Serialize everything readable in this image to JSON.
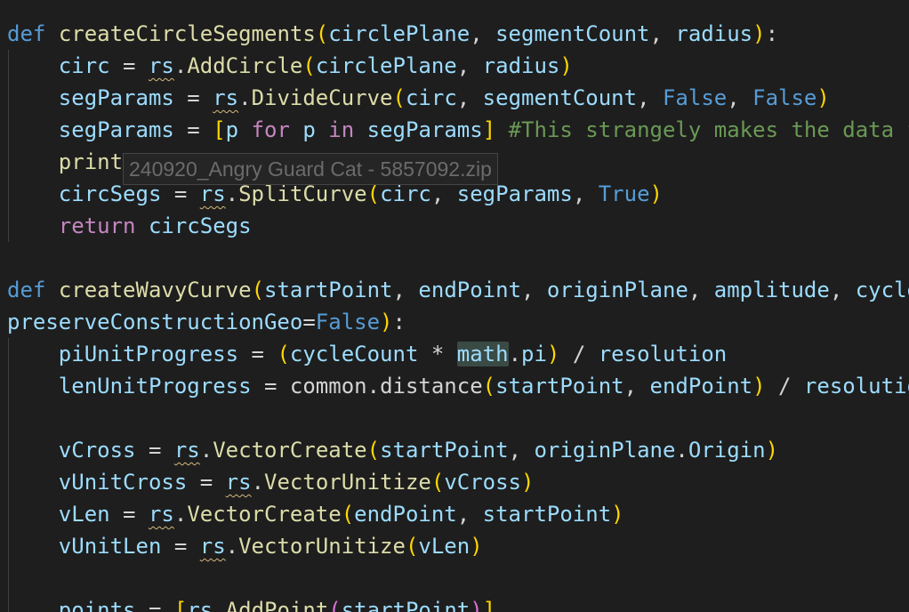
{
  "tooltip": {
    "filename": "240920_Angry Guard Cat - 5857092.zip"
  },
  "code": {
    "l1": {
      "def": "def",
      "fname": "createCircleSegments",
      "p1": "circlePlane",
      "p2": "segmentCount",
      "p3": "radius"
    },
    "l2": {
      "var": "circ",
      "mod": "rs",
      "call": "AddCircle",
      "a1": "circlePlane",
      "a2": "radius"
    },
    "l3": {
      "var": "segParams",
      "mod": "rs",
      "call": "DivideCurve",
      "a1": "circ",
      "a2": "segmentCount",
      "a3": "False",
      "a4": "False"
    },
    "l4": {
      "var": "segParams",
      "item": "p",
      "for_kw": "for",
      "item2": "p",
      "in_kw": "in",
      "iter": "segParams",
      "comment": "#This strangely makes the data f"
    },
    "l5": {
      "call": "print"
    },
    "l6": {
      "var": "circSegs",
      "mod": "rs",
      "call": "SplitCurve",
      "a1": "circ",
      "a2": "segParams",
      "a3": "True"
    },
    "l7": {
      "ret": "return",
      "val": "circSegs"
    },
    "l9": {
      "def": "def",
      "fname": "createWavyCurve",
      "p1": "startPoint",
      "p2": "endPoint",
      "p3": "originPlane",
      "p4": "amplitude",
      "p5": "cycleC"
    },
    "l10": {
      "p": "preserveConstructionGeo",
      "val": "False"
    },
    "l11": {
      "var": "piUnitProgress",
      "a1": "cycleCount",
      "mod": "math",
      "attr": "pi",
      "a2": "resolution"
    },
    "l12": {
      "var": "lenUnitProgress",
      "mod": "common",
      "call": "distance",
      "a1": "startPoint",
      "a2": "endPoint",
      "a3": "resolutio"
    },
    "l14": {
      "var": "vCross",
      "mod": "rs",
      "call": "VectorCreate",
      "a1": "startPoint",
      "a2": "originPlane",
      "attr": "Origin"
    },
    "l15": {
      "var": "vUnitCross",
      "mod": "rs",
      "call": "VectorUnitize",
      "a1": "vCross"
    },
    "l16": {
      "var": "vLen",
      "mod": "rs",
      "call": "VectorCreate",
      "a1": "endPoint",
      "a2": "startPoint"
    },
    "l17": {
      "var": "vUnitLen",
      "mod": "rs",
      "call": "VectorUnitize",
      "a1": "vLen"
    },
    "l19": {
      "var": "points",
      "mod": "rs",
      "call": "AddPoint",
      "a1": "startPoint"
    }
  },
  "colors": {
    "background": "#1e1e1e",
    "keyword": "#569cd6",
    "control": "#c586c0",
    "function": "#dcdcaa",
    "variable": "#9cdcfe",
    "comment": "#6a9955",
    "bracket1": "#ffd700",
    "bracket2": "#da70d6"
  }
}
